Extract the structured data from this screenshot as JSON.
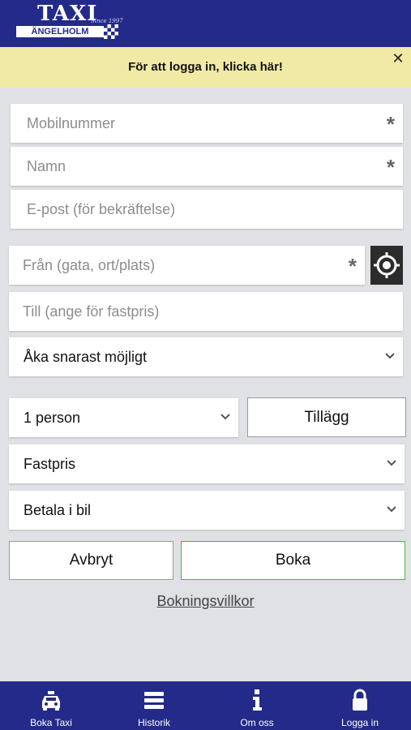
{
  "header": {
    "logo_title": "TAXI",
    "logo_since": "Since 1997",
    "logo_city": "ÄNGELHOLM"
  },
  "banner": {
    "text": "För att logga in, klicka här!",
    "close": "✕"
  },
  "form": {
    "mobile_placeholder": "Mobilnummer",
    "name_placeholder": "Namn",
    "email_placeholder": "E-post (för bekräftelse)",
    "from_placeholder": "Från (gata, ort/plats)",
    "to_placeholder": "Till (ange för fastpris)",
    "when_value": "Åka snarast möjligt",
    "persons_value": "1 person",
    "extras_label": "Tillägg",
    "price_value": "Fastpris",
    "payment_value": "Betala i bil",
    "required_mark": "*"
  },
  "actions": {
    "cancel_label": "Avbryt",
    "book_label": "Boka",
    "terms_link": "Bokningsvillkor"
  },
  "tabbar": {
    "items": [
      {
        "label": "Boka Taxi",
        "icon": "taxi-icon"
      },
      {
        "label": "Historik",
        "icon": "menu-icon"
      },
      {
        "label": "Om oss",
        "icon": "info-icon"
      },
      {
        "label": "Logga in",
        "icon": "lock-icon"
      }
    ]
  },
  "colors": {
    "brand": "#232a8a",
    "banner": "#f1eaa6",
    "book_border": "#43b548",
    "background": "#dfe1e4"
  }
}
